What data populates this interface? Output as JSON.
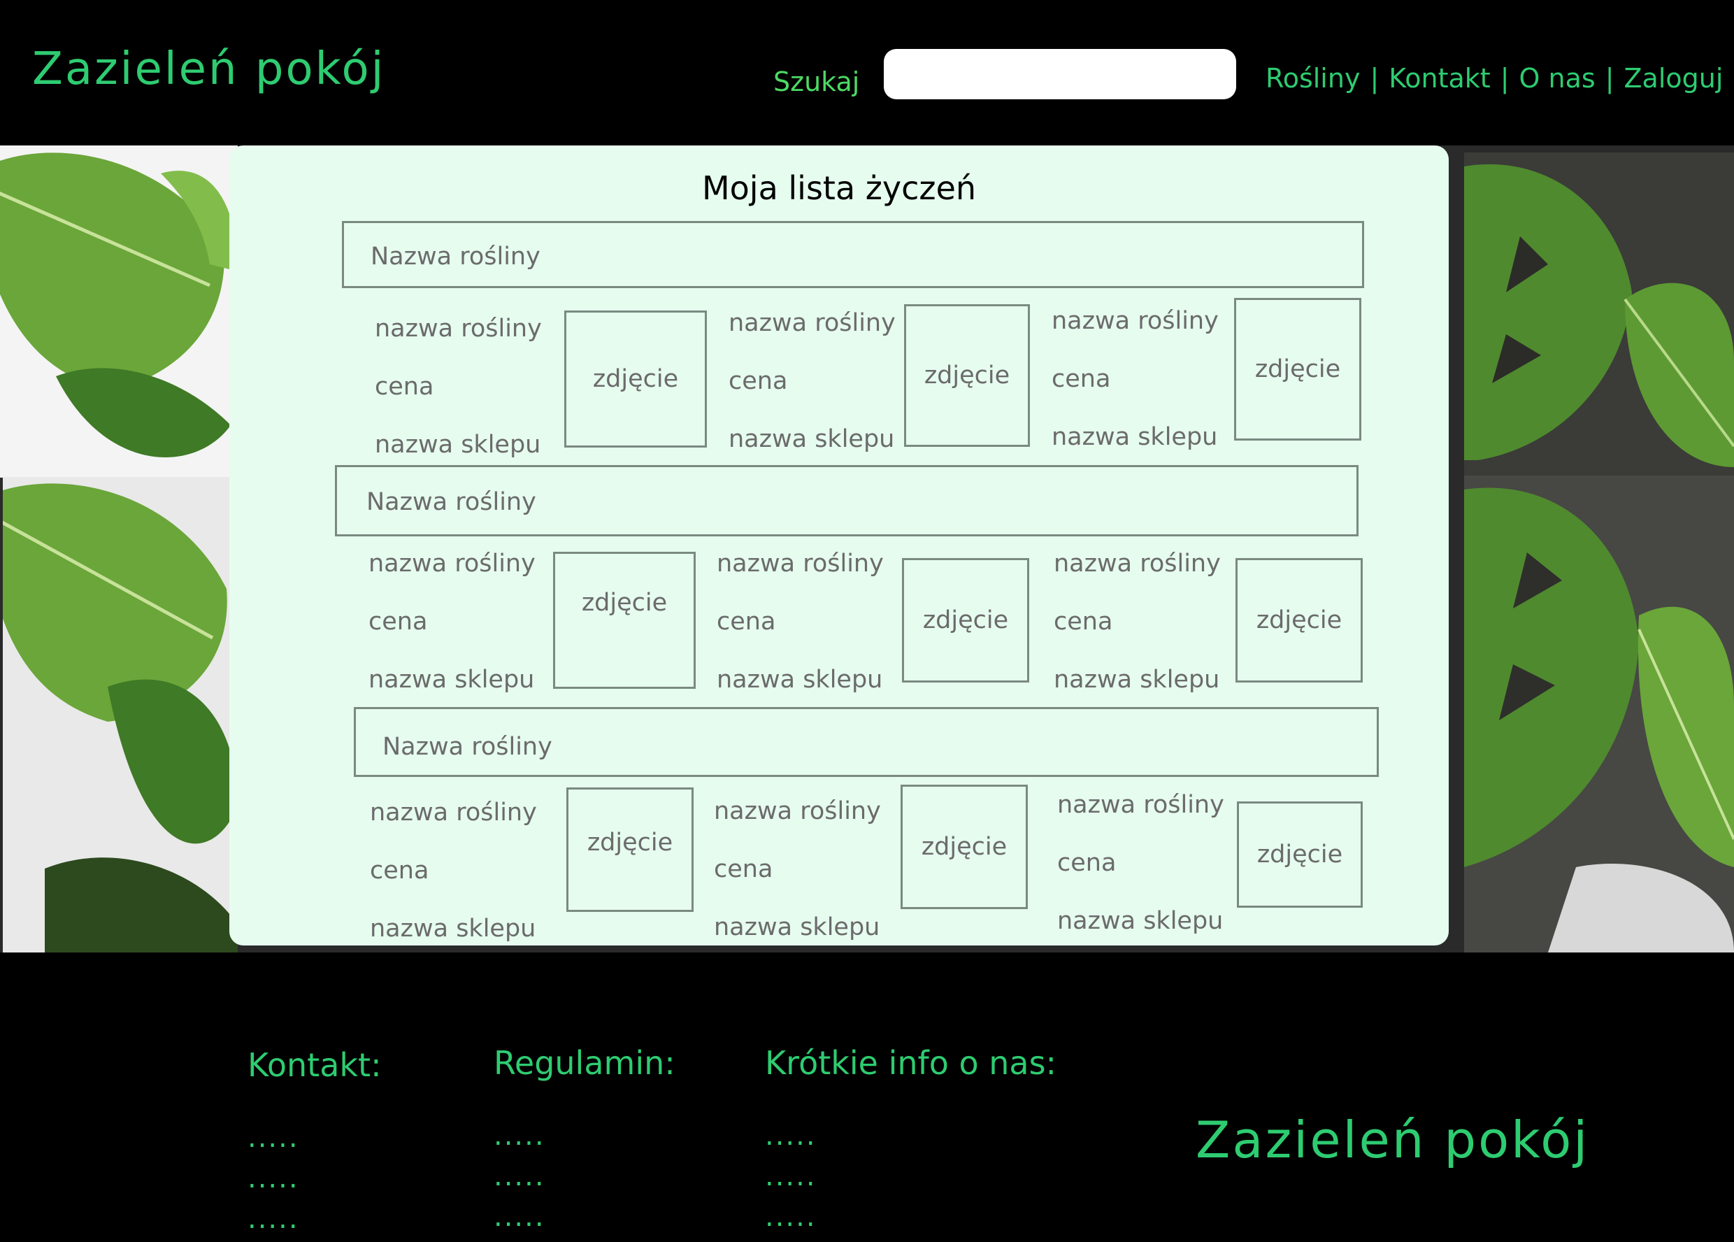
{
  "header": {
    "logo": "Zazieleń pokój",
    "search_label": "Szukaj",
    "search_value": "",
    "nav": [
      "Rośliny",
      "Kontakt",
      "O nas",
      "Zaloguj"
    ],
    "nav_separator": "|"
  },
  "wishlist": {
    "title": "Moja lista życzeń",
    "groups": [
      {
        "label": "Nazwa rośliny",
        "items": [
          {
            "name": "nazwa rośliny",
            "price": "cena",
            "shop": "nazwa sklepu",
            "photo": "zdjęcie"
          },
          {
            "name": "nazwa rośliny",
            "price": "cena",
            "shop": "nazwa sklepu",
            "photo": "zdjęcie"
          },
          {
            "name": "nazwa rośliny",
            "price": "cena",
            "shop": "nazwa sklepu",
            "photo": "zdjęcie"
          }
        ]
      },
      {
        "label": "Nazwa rośliny",
        "items": [
          {
            "name": "nazwa rośliny",
            "price": "cena",
            "shop": "nazwa sklepu",
            "photo": "zdjęcie"
          },
          {
            "name": "nazwa rośliny",
            "price": "cena",
            "shop": "nazwa sklepu",
            "photo": "zdjęcie"
          },
          {
            "name": "nazwa rośliny",
            "price": "cena",
            "shop": "nazwa sklepu",
            "photo": "zdjęcie"
          }
        ]
      },
      {
        "label": "Nazwa rośliny",
        "items": [
          {
            "name": "nazwa rośliny",
            "price": "cena",
            "shop": "nazwa sklepu",
            "photo": "zdjęcie"
          },
          {
            "name": "nazwa rośliny",
            "price": "cena",
            "shop": "nazwa sklepu",
            "photo": "zdjęcie"
          },
          {
            "name": "nazwa rośliny",
            "price": "cena",
            "shop": "nazwa sklepu",
            "photo": "zdjęcie"
          }
        ]
      }
    ]
  },
  "footer": {
    "columns": [
      {
        "heading": "Kontakt:",
        "lines": [
          ".....",
          ".....",
          "....."
        ]
      },
      {
        "heading": "Regulamin:",
        "lines": [
          ".....",
          ".....",
          "....."
        ]
      },
      {
        "heading": "Krótkie info o nas:",
        "lines": [
          ".....",
          ".....",
          "....."
        ]
      }
    ],
    "logo": "Zazieleń pokój"
  },
  "colors": {
    "accent_green": "#2ecc71",
    "card_bg": "#e6fcef",
    "page_bg": "#000000"
  }
}
